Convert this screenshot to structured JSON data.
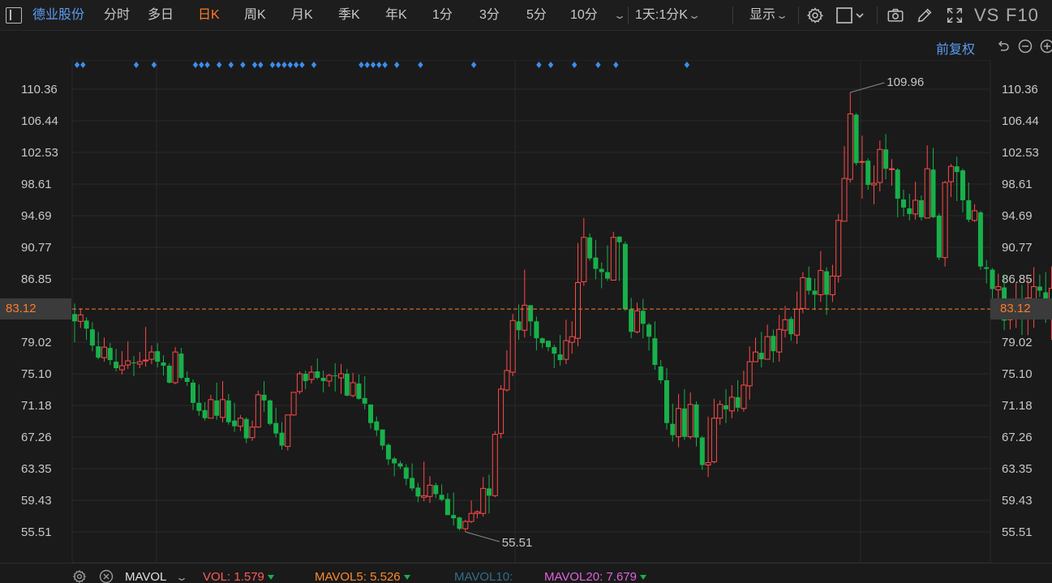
{
  "toolbar": {
    "stock_name": "德业股份",
    "periods": [
      "分时",
      "多日",
      "日K",
      "周K",
      "月K",
      "季K",
      "年K",
      "1分",
      "3分",
      "5分",
      "10分"
    ],
    "active_period": "日K",
    "multi_view": "1天:1分K",
    "display_label": "显示",
    "vs_label": "VS",
    "f10_label": "F10"
  },
  "subbar": {
    "adjust_label": "前复权"
  },
  "chart": {
    "y_ticks": [
      "110.36",
      "106.44",
      "102.53",
      "98.61",
      "94.69",
      "90.77",
      "86.85",
      "83.12",
      "79.02",
      "75.10",
      "71.18",
      "67.26",
      "63.35",
      "59.43",
      "55.51"
    ],
    "current_price": "83.12",
    "high_label": "109.96",
    "low_label": "55.51",
    "colors": {
      "up": "#ff4a4a",
      "down": "#18b04a",
      "current_line": "#ff7a2b",
      "event_marker": "#3a8ef0",
      "grid": "#2a2a2a"
    }
  },
  "chart_data": {
    "type": "candlestick",
    "ylim": [
      53.5,
      113.0
    ],
    "high": 109.96,
    "low": 55.51,
    "current": 83.12,
    "candles": [
      [
        82.5,
        81.6,
        83.8,
        79.0
      ],
      [
        81.6,
        82.4,
        83.2,
        80.8
      ],
      [
        81.7,
        80.7,
        82.1,
        79.3
      ],
      [
        80.6,
        78.6,
        81.5,
        77.9
      ],
      [
        78.5,
        77.1,
        80.3,
        76.9
      ],
      [
        77.1,
        78.4,
        79.6,
        76.6
      ],
      [
        78.3,
        76.8,
        78.9,
        76.2
      ],
      [
        76.6,
        75.8,
        78.2,
        75.4
      ],
      [
        75.6,
        76.1,
        77.9,
        75.0
      ],
      [
        76.2,
        76.7,
        79.1,
        75.7
      ],
      [
        76.5,
        76.4,
        77.3,
        74.8
      ],
      [
        76.3,
        76.6,
        77.8,
        75.8
      ],
      [
        76.7,
        76.8,
        80.9,
        76.0
      ],
      [
        76.9,
        77.8,
        78.6,
        76.3
      ],
      [
        77.9,
        76.6,
        78.9,
        75.9
      ],
      [
        76.5,
        76.1,
        77.4,
        74.9
      ],
      [
        76.1,
        74.0,
        76.4,
        73.9
      ],
      [
        74.0,
        77.8,
        78.4,
        73.8
      ],
      [
        77.6,
        74.6,
        78.3,
        74.4
      ],
      [
        74.6,
        74.1,
        75.4,
        73.6
      ],
      [
        74.0,
        71.5,
        74.4,
        70.6
      ],
      [
        71.5,
        70.5,
        73.8,
        69.9
      ],
      [
        70.6,
        69.6,
        71.6,
        69.3
      ],
      [
        69.6,
        71.9,
        72.5,
        69.6
      ],
      [
        71.8,
        69.9,
        74.0,
        69.4
      ],
      [
        69.7,
        71.9,
        74.2,
        69.1
      ],
      [
        71.8,
        69.1,
        72.6,
        68.8
      ],
      [
        69.3,
        68.6,
        71.5,
        67.9
      ],
      [
        68.6,
        69.6,
        70.0,
        68.0
      ],
      [
        69.5,
        67.1,
        69.7,
        66.5
      ],
      [
        67.2,
        68.5,
        69.3,
        66.8
      ],
      [
        68.5,
        72.5,
        73.0,
        68.4
      ],
      [
        72.5,
        71.8,
        74.2,
        70.4
      ],
      [
        71.8,
        68.9,
        71.9,
        68.7
      ],
      [
        69.0,
        67.7,
        70.9,
        67.2
      ],
      [
        67.8,
        66.2,
        69.1,
        65.7
      ],
      [
        66.1,
        70.0,
        70.0,
        65.6
      ],
      [
        70.0,
        72.8,
        72.8,
        69.9
      ],
      [
        72.9,
        75.1,
        75.4,
        72.6
      ],
      [
        75.1,
        74.2,
        75.5,
        73.2
      ],
      [
        74.4,
        75.3,
        76.1,
        73.9
      ],
      [
        75.4,
        74.6,
        77.0,
        74.4
      ],
      [
        74.6,
        74.2,
        75.5,
        72.8
      ],
      [
        74.2,
        74.9,
        75.1,
        73.5
      ],
      [
        74.9,
        74.8,
        76.4,
        72.9
      ],
      [
        74.6,
        75.1,
        76.3,
        72.6
      ],
      [
        75.1,
        72.4,
        75.7,
        72.3
      ],
      [
        72.4,
        74.0,
        75.2,
        72.2
      ],
      [
        73.9,
        72.0,
        75.0,
        71.9
      ],
      [
        72.1,
        71.4,
        74.8,
        70.7
      ],
      [
        71.3,
        69.0,
        71.3,
        68.3
      ],
      [
        69.2,
        68.1,
        69.8,
        67.4
      ],
      [
        68.2,
        66.2,
        68.2,
        65.7
      ],
      [
        66.3,
        64.5,
        66.5,
        63.8
      ],
      [
        64.6,
        64.0,
        64.8,
        62.4
      ],
      [
        64.0,
        63.6,
        64.3,
        63.3
      ],
      [
        63.5,
        62.1,
        63.9,
        61.3
      ],
      [
        62.2,
        60.9,
        64.0,
        60.6
      ],
      [
        61.0,
        59.9,
        61.6,
        59.2
      ],
      [
        59.8,
        60.0,
        64.2,
        59.3
      ],
      [
        59.9,
        61.3,
        62.4,
        59.1
      ],
      [
        61.3,
        60.2,
        61.6,
        59.7
      ],
      [
        60.1,
        59.5,
        61.4,
        59.3
      ],
      [
        59.6,
        57.6,
        60.3,
        57.6
      ],
      [
        57.6,
        57.2,
        60.4,
        56.3
      ],
      [
        57.3,
        55.9,
        57.4,
        55.7
      ],
      [
        55.9,
        56.8,
        57.0,
        55.5
      ],
      [
        56.8,
        57.8,
        59.4,
        56.6
      ],
      [
        57.8,
        58.0,
        58.2,
        57.2
      ],
      [
        57.8,
        60.9,
        62.3,
        57.4
      ],
      [
        60.9,
        60.0,
        62.6,
        57.8
      ],
      [
        60.0,
        67.6,
        68.0,
        59.8
      ],
      [
        67.7,
        73.2,
        73.7,
        67.1
      ],
      [
        73.1,
        75.5,
        78.0,
        72.9
      ],
      [
        75.3,
        81.7,
        82.5,
        74.8
      ],
      [
        81.6,
        80.5,
        83.7,
        79.3
      ],
      [
        80.5,
        83.6,
        88.0,
        79.6
      ],
      [
        83.6,
        81.6,
        83.6,
        79.8
      ],
      [
        81.6,
        79.5,
        82.2,
        78.0
      ],
      [
        79.5,
        78.9,
        79.6,
        78.3
      ],
      [
        79.2,
        78.4,
        78.6,
        77.9
      ],
      [
        78.4,
        77.6,
        78.7,
        75.8
      ],
      [
        77.5,
        76.8,
        79.9,
        76.1
      ],
      [
        76.9,
        79.2,
        81.8,
        76.3
      ],
      [
        79.0,
        79.7,
        81.6,
        77.6
      ],
      [
        79.5,
        86.4,
        91.3,
        78.5
      ],
      [
        86.5,
        92.0,
        94.4,
        86.0
      ],
      [
        92.0,
        89.4,
        92.5,
        89.1
      ],
      [
        89.5,
        88.1,
        91.7,
        86.8
      ],
      [
        88.1,
        87.7,
        88.9,
        85.7
      ],
      [
        87.7,
        86.9,
        91.0,
        86.6
      ],
      [
        86.7,
        92.0,
        92.7,
        86.8
      ],
      [
        92.1,
        91.4,
        92.1,
        86.6
      ],
      [
        91.2,
        83.1,
        91.5,
        82.9
      ],
      [
        83.1,
        80.3,
        84.5,
        79.5
      ],
      [
        80.3,
        82.9,
        83.9,
        80.1
      ],
      [
        82.9,
        81.3,
        84.4,
        79.5
      ],
      [
        81.2,
        79.7,
        81.4,
        78.0
      ],
      [
        79.5,
        76.2,
        81.6,
        75.6
      ],
      [
        76.0,
        74.3,
        76.8,
        73.9
      ],
      [
        74.3,
        69.0,
        75.8,
        68.2
      ],
      [
        68.9,
        67.5,
        71.4,
        66.7
      ],
      [
        67.3,
        70.8,
        72.6,
        66.0
      ],
      [
        70.8,
        67.3,
        73.2,
        66.9
      ],
      [
        67.3,
        71.3,
        72.8,
        67.0
      ],
      [
        71.3,
        67.2,
        71.7,
        66.1
      ],
      [
        67.2,
        63.8,
        67.4,
        63.2
      ],
      [
        63.8,
        64.1,
        69.8,
        62.3
      ],
      [
        64.2,
        69.6,
        72.0,
        64.0
      ],
      [
        69.6,
        71.3,
        71.8,
        68.8
      ],
      [
        71.2,
        70.7,
        73.2,
        69.0
      ],
      [
        70.5,
        72.2,
        73.7,
        69.6
      ],
      [
        72.2,
        70.9,
        74.3,
        70.4
      ],
      [
        70.8,
        73.7,
        75.5,
        70.4
      ],
      [
        73.6,
        76.6,
        78.5,
        71.9
      ],
      [
        76.6,
        77.8,
        79.6,
        77.3
      ],
      [
        77.7,
        76.9,
        80.3,
        75.9
      ],
      [
        76.9,
        79.7,
        81.2,
        78.0
      ],
      [
        79.8,
        77.9,
        80.6,
        76.5
      ],
      [
        77.8,
        80.6,
        82.4,
        76.6
      ],
      [
        80.5,
        81.8,
        83.5,
        79.6
      ],
      [
        81.9,
        80.0,
        82.2,
        79.2
      ],
      [
        79.9,
        83.1,
        85.3,
        78.8
      ],
      [
        83.2,
        87.0,
        87.7,
        82.6
      ],
      [
        87.0,
        85.4,
        88.4,
        84.9
      ],
      [
        85.4,
        84.9,
        86.9,
        83.0
      ],
      [
        84.9,
        87.9,
        90.3,
        84.0
      ],
      [
        87.8,
        84.9,
        88.3,
        82.4
      ],
      [
        84.9,
        87.2,
        88.6,
        84.0
      ],
      [
        87.2,
        94.1,
        94.9,
        86.4
      ],
      [
        94.0,
        99.3,
        103.3,
        97.5
      ],
      [
        99.2,
        107.3,
        109.96,
        98.8
      ],
      [
        107.2,
        101.2,
        107.4,
        100.9
      ],
      [
        101.3,
        101.4,
        104.6,
        96.8
      ],
      [
        101.5,
        98.5,
        101.8,
        97.9
      ],
      [
        98.5,
        98.7,
        100.9,
        96.1
      ],
      [
        98.8,
        102.9,
        104.0,
        97.7
      ],
      [
        102.9,
        100.5,
        104.8,
        99.2
      ],
      [
        100.5,
        100.5,
        101.7,
        98.4
      ],
      [
        100.4,
        96.8,
        100.6,
        94.5
      ],
      [
        96.7,
        95.7,
        97.9,
        94.6
      ],
      [
        95.6,
        94.9,
        97.4,
        94.1
      ],
      [
        94.9,
        96.6,
        98.9,
        94.2
      ],
      [
        96.6,
        94.5,
        97.2,
        94.1
      ],
      [
        94.4,
        100.5,
        103.4,
        96.6
      ],
      [
        100.4,
        94.5,
        103.1,
        94.4
      ],
      [
        94.7,
        89.5,
        95.0,
        89.2
      ],
      [
        89.5,
        98.8,
        99.0,
        88.4
      ],
      [
        98.9,
        100.8,
        101.1,
        97.0
      ],
      [
        100.8,
        100.1,
        102.0,
        96.5
      ],
      [
        100.3,
        96.6,
        100.5,
        95.1
      ],
      [
        96.6,
        94.2,
        98.8,
        93.9
      ],
      [
        94.1,
        95.3,
        96.1,
        93.9
      ],
      [
        95.1,
        88.4,
        95.3,
        88.0
      ],
      [
        88.3,
        88.1,
        89.2,
        86.3
      ],
      [
        88.0,
        85.6,
        88.2,
        83.5
      ],
      [
        85.5,
        85.9,
        87.5,
        84.1
      ],
      [
        85.8,
        81.7,
        87.4,
        80.5
      ],
      [
        81.8,
        82.0,
        84.0,
        80.6
      ],
      [
        81.9,
        83.4,
        86.4,
        80.8
      ],
      [
        83.4,
        82.2,
        86.1,
        79.9
      ],
      [
        82.0,
        84.5,
        86.8,
        79.9
      ],
      [
        84.4,
        85.9,
        88.3,
        80.8
      ],
      [
        85.9,
        85.4,
        87.4,
        84.6
      ],
      [
        85.2,
        82.2,
        87.7,
        81.4
      ],
      [
        82.3,
        85.7,
        88.4,
        79.3
      ],
      [
        85.8,
        84.6,
        86.3,
        82.8
      ],
      [
        84.8,
        85.3,
        86.4,
        81.4
      ]
    ],
    "events": [
      0,
      1,
      10,
      13,
      20,
      21,
      22,
      24,
      26,
      28,
      30,
      31,
      33,
      34,
      35,
      36,
      37,
      38,
      40,
      48,
      49,
      50,
      51,
      52,
      54,
      58,
      67,
      78,
      80,
      84,
      88,
      91,
      103
    ]
  },
  "bottom": {
    "indicator": "MAVOL",
    "vol_label": "VOL:",
    "vol_value": "1.579",
    "ma5_label": "MAVOL5:",
    "ma5_value": "5.526",
    "ma10_label": "MAVOL10:",
    "ma20_label": "MAVOL20:",
    "ma20_value": "7.679"
  }
}
